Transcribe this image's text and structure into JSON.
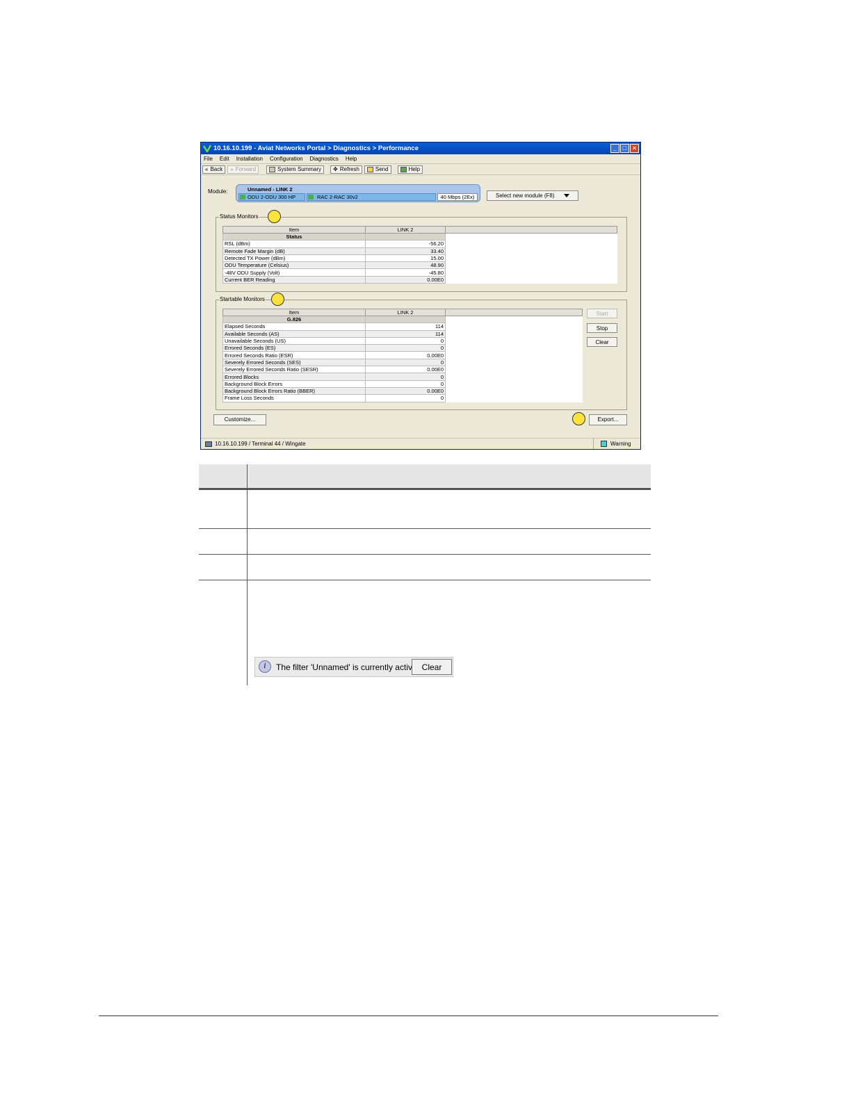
{
  "window": {
    "title": "10.16.10.199  -  Aviat Networks Portal > Diagnostics > Performance",
    "buttons": [
      "_",
      "□",
      "×"
    ]
  },
  "menu": [
    "File",
    "Edit",
    "Installation",
    "Configuration",
    "Diagnostics",
    "Help"
  ],
  "toolbar": {
    "back": "Back",
    "forward": "Forward",
    "system_summary": "System Summary",
    "refresh": "Refresh",
    "send": "Send",
    "help": "Help"
  },
  "module": {
    "label": "Module:",
    "name": "Unnamed - LINK 2",
    "odu": "ODU 2-ODU 300 HP",
    "rac": "RAC 2-RAC 30v2",
    "rate": "40 Mbps (2Ex)",
    "select": "Select new module (F8)"
  },
  "status_monitors": {
    "title": "Status Monitors",
    "columns": [
      "Item",
      "LINK 2"
    ],
    "section": "Status",
    "rows": [
      {
        "item": "RSL (dBm)",
        "value": "-56.20"
      },
      {
        "item": "Remote Fade Margin (dB)",
        "value": "33.40"
      },
      {
        "item": "Detected TX Power (dBm)",
        "value": "15.00"
      },
      {
        "item": "ODU Temperature (Celsius)",
        "value": "48.90"
      },
      {
        "item": "-48V ODU Supply (Volt)",
        "value": "-45.80"
      },
      {
        "item": "Current BER Reading",
        "value": "0.00E0"
      }
    ]
  },
  "startable_monitors": {
    "title": "Startable Monitors",
    "columns": [
      "Item",
      "LINK 2"
    ],
    "section": "G.826",
    "rows": [
      {
        "item": "Elapsed Seconds",
        "value": "114"
      },
      {
        "item": "Available Seconds (AS)",
        "value": "114"
      },
      {
        "item": "Unavailable Seconds (US)",
        "value": "0"
      },
      {
        "item": "Errored Seconds (ES)",
        "value": "0"
      },
      {
        "item": "Errored Seconds Ratio (ESR)",
        "value": "0.00E0"
      },
      {
        "item": "Severely Errored Seconds (SES)",
        "value": "0"
      },
      {
        "item": "Severely Errored Seconds Ratio (SESR)",
        "value": "0.00E0"
      },
      {
        "item": "Errored Blocks",
        "value": "0"
      },
      {
        "item": "Background Block Errors",
        "value": "0"
      },
      {
        "item": "Background Block Errors Ratio (BBER)",
        "value": "0.00E0"
      },
      {
        "item": "Frame Loss Seconds",
        "value": "0"
      }
    ],
    "buttons": {
      "start": "Start",
      "stop": "Stop",
      "clear": "Clear"
    }
  },
  "bottom": {
    "customize": "Customize...",
    "export": "Export..."
  },
  "statusbar": {
    "connection": "10.16.10.199 / Terminal 44 / Wingate",
    "warning": "Warning"
  },
  "filter_bar": {
    "text": "The filter 'Unnamed' is currently active",
    "clear": "Clear",
    "icon": "info-icon"
  },
  "colors": {
    "callout": "#ffe23c",
    "titlebar": "#0a5fd8",
    "module": "#a9c6ea"
  }
}
